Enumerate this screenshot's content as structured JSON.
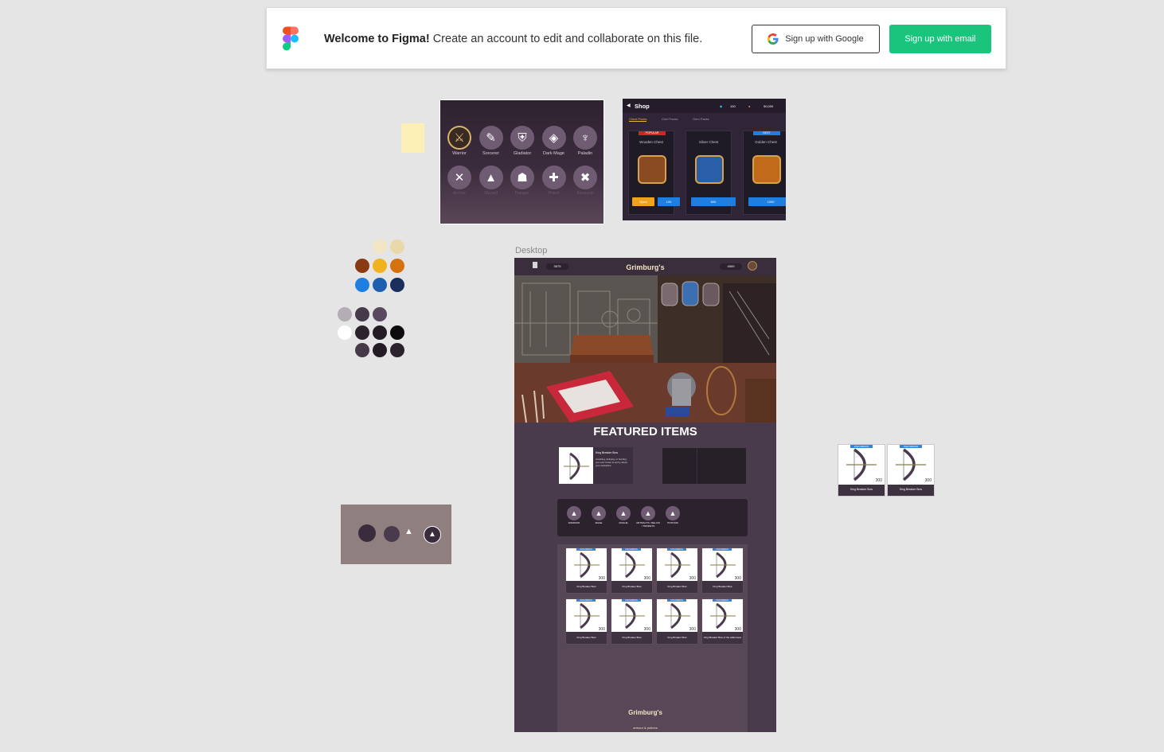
{
  "banner": {
    "title_bold": "Welcome to Figma!",
    "title_rest": " Create an account to edit and collaborate on this file.",
    "google_button": "Sign up with Google",
    "email_button": "Sign up with email"
  },
  "classes": [
    {
      "label": "Warrior",
      "icon": "⚔",
      "active": true
    },
    {
      "label": "Sorcerer",
      "icon": "✎"
    },
    {
      "label": "Gladiator",
      "icon": "⛨"
    },
    {
      "label": "Dark Mage",
      "icon": "◈"
    },
    {
      "label": "Paladin",
      "icon": "♆"
    },
    {
      "label": "Archer",
      "icon": "✕",
      "dim": true
    },
    {
      "label": "Wizard",
      "icon": "▲",
      "dim": true
    },
    {
      "label": "Ranger",
      "icon": "☗",
      "dim": true
    },
    {
      "label": "Priest",
      "icon": "✚",
      "dim": true
    },
    {
      "label": "Assassin",
      "icon": "✖",
      "dim": true
    }
  ],
  "shop": {
    "title": "Shop",
    "gems": "100",
    "gold": "50,000",
    "tabs": [
      "Chest Packs",
      "Gold Packs",
      "Gem Packs"
    ],
    "chests": [
      {
        "name": "Wooden Chest",
        "badge": "POPULAR",
        "badge_color": "#d2232a",
        "price": "100",
        "open": "Open",
        "color": "#8a4a22"
      },
      {
        "name": "Silver Chest",
        "badge": "",
        "price": "600",
        "color": "#2a5ea8"
      },
      {
        "name": "Golden Chest",
        "badge": "BEST",
        "badge_color": "#1f7fe0",
        "price": "1000",
        "color": "#c06a1a"
      }
    ]
  },
  "swatch_colors": {
    "row1": [
      "#f3e6c5",
      "#ead9a8"
    ],
    "row2": [
      "#8a3a12",
      "#f0b21f",
      "#d4720f"
    ],
    "row3": [
      "#1f7fe0",
      "#1e5fb0",
      "#1b2f5e"
    ],
    "row4": [
      "#b5adb5",
      "#463a4a",
      "#5a4760"
    ],
    "row5": [
      "#ffffff",
      "#2b222d",
      "#231c25",
      "#0e0c0f"
    ],
    "row6": [
      "#463a4a",
      "#231c25",
      "#2b222d"
    ]
  },
  "desktop": {
    "frame_label": "Desktop",
    "shop_name": "Grimburg's",
    "shop_sub": "armour & potions",
    "gems": "3675",
    "gold": "4500",
    "featured_title": "FEATURED ITEMS",
    "featured": {
      "name": "King Breaker Bow",
      "desc": "Cracking, deifying, or hunting you won't have to worry about your obstacles."
    },
    "categories": [
      {
        "label": "WARRIOR"
      },
      {
        "label": "MAGE"
      },
      {
        "label": "ROGUE"
      },
      {
        "label": "ARTIFACTS / RELICS / TRINKETS"
      },
      {
        "label": "POTIONS"
      }
    ],
    "items": [
      {
        "rarity": "UNCOMMON",
        "price": "300",
        "name": "King Breaker Bow"
      },
      {
        "rarity": "UNCOMMON",
        "price": "300",
        "name": "King Breaker Bow"
      },
      {
        "rarity": "UNCOMMON",
        "price": "300",
        "name": "King Breaker Bow"
      },
      {
        "rarity": "UNCOMMON",
        "price": "300",
        "name": "King Breaker Bow"
      },
      {
        "rarity": "UNCOMMON",
        "price": "300",
        "name": "King Breaker Bow"
      },
      {
        "rarity": "UNCOMMON",
        "price": "300",
        "name": "King Breaker Bow"
      },
      {
        "rarity": "UNCOMMON",
        "price": "300",
        "name": "King Breaker Bow"
      },
      {
        "rarity": "UNCOMMON",
        "price": "300",
        "name": "King Breaker Bow of the wilderness"
      }
    ]
  },
  "side_cards": [
    {
      "rarity": "UNCOMMON",
      "price": "300",
      "name": "King Breaker Bow"
    },
    {
      "rarity": "UNCOMMON",
      "price": "300",
      "name": "King Breaker Bow"
    }
  ]
}
